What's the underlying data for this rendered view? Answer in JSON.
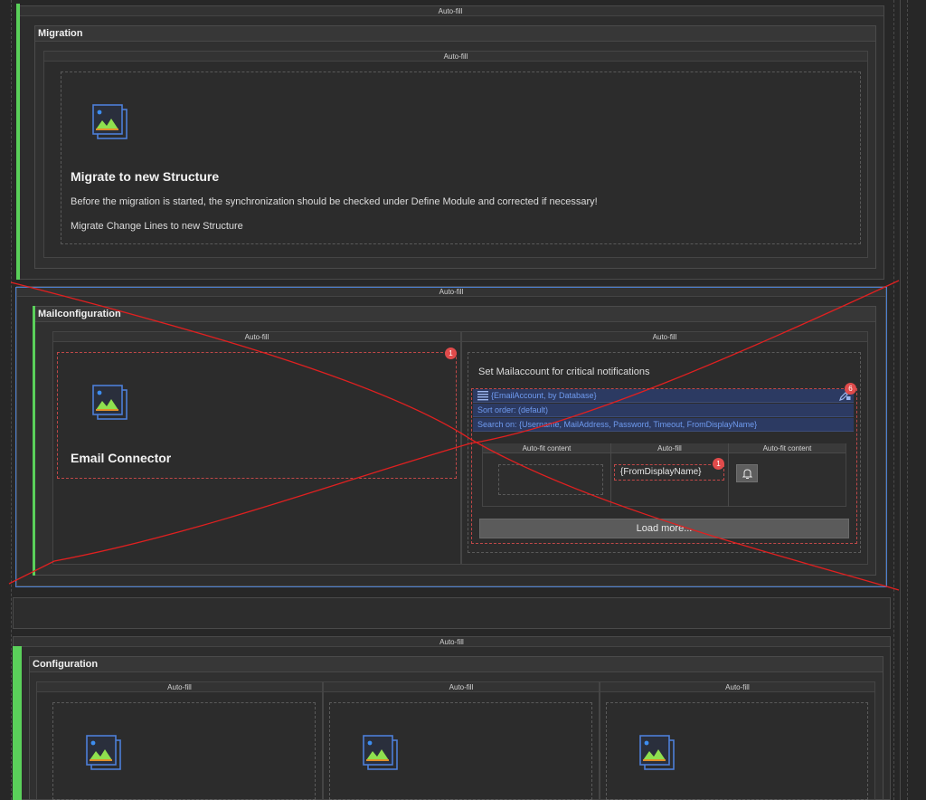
{
  "header_label": "Auto-fill",
  "migration": {
    "title": "Migration",
    "inner_label": "Auto-fill",
    "heading": "Migrate to new Structure",
    "description": "Before the migration is started, the synchronization should be checked under Define Module and corrected if necessary!",
    "link_text": "Migrate Change Lines to new Structure"
  },
  "mail": {
    "header_label": "Auto-fill",
    "title": "Mailconfiguration",
    "left_label": "Auto-fill",
    "right_label": "Auto-fill",
    "left_badge": "1",
    "left_heading": "Email Connector",
    "notify_label": "Set Mailaccount for critical notifications",
    "source_badge": "6",
    "source_line": "{EmailAccount, by Database}",
    "sort_line": "Sort order: (default)",
    "search_line": "Search on: {Username, MailAddress, Password, Timeout, FromDisplayName}",
    "grid_headers": [
      "Auto-fit content",
      "Auto-fill",
      "Auto-fit content"
    ],
    "field_value": "{FromDisplayName}",
    "field_badge": "1",
    "load_more": "Load more..."
  },
  "config": {
    "header_label": "Auto-fill",
    "title": "Configuration",
    "column_labels": [
      "Auto-fill",
      "Auto-fill",
      "Auto-fill"
    ]
  },
  "colors": {
    "accent_green": "#5ad05a",
    "selection_blue": "#4b7fd1",
    "error_red": "#e04b4b",
    "link_blue": "#6f9bf0"
  }
}
